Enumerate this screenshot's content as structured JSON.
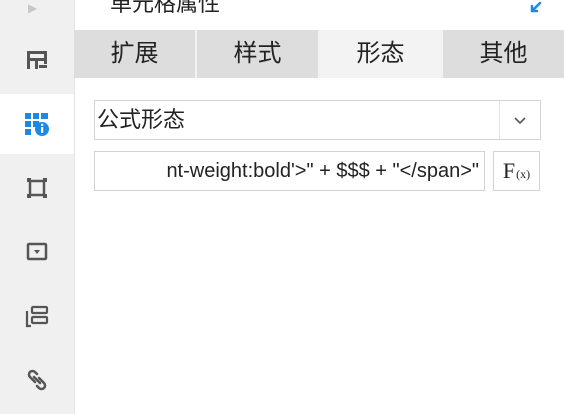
{
  "panel": {
    "title": "单元格属性"
  },
  "tabs": [
    {
      "label": "扩展",
      "active": false
    },
    {
      "label": "样式",
      "active": false
    },
    {
      "label": "形态",
      "active": true
    },
    {
      "label": "其他",
      "active": false
    }
  ],
  "state_select": {
    "value": "公式形态"
  },
  "formula": {
    "value": "nt-weight:bold'>\" + $$$ + \"</span>\"",
    "fx_main": "F",
    "fx_sub": "(x)"
  },
  "colors": {
    "accent": "#1e88e5",
    "rail_icon": "#555555",
    "rail_active_icon": "#1e88e5"
  },
  "rail_icons": [
    "table-icon",
    "cell-attributes-icon",
    "border-frame-icon",
    "dropdown-widget-icon",
    "layers-icon",
    "link-icon"
  ]
}
